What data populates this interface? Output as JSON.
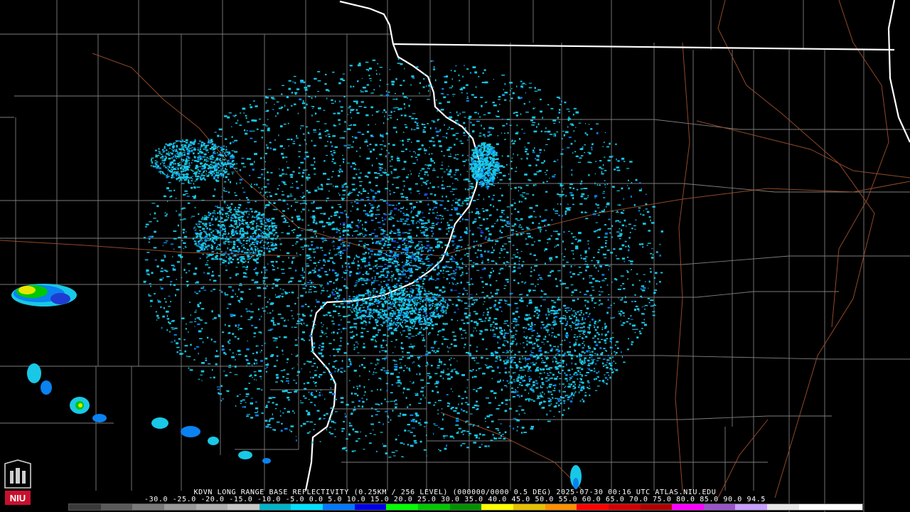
{
  "header": {
    "title": "KDVN LONG RANGE BASE REFLECTIVITY (0.25KM / 256 LEVEL) (000000/0000 0.5 DEG) 2025-07-30 00:16 UTC  ATLAS.NIU.EDU"
  },
  "legend": {
    "scale_text": "-30.0 -25.0 -20.0 -15.0 -10.0 -5.0  0.0   5.0  10.0  15.0  20.0  25.0  30.0  35.0  40.0  45.0  50.0  55.0  60.0  65.0  70.0  75.0  80.0  85.0  90.0  94.5",
    "colors": [
      "#3a3a3a",
      "#5a5a5a",
      "#7a7a7a",
      "#9a9a9a",
      "#b0b0b0",
      "#c8c8c8",
      "#00b4c8",
      "#00e0ff",
      "#0078ff",
      "#0000e6",
      "#00ff00",
      "#00c800",
      "#009000",
      "#ffff00",
      "#e6c000",
      "#ff9000",
      "#ff0000",
      "#d40000",
      "#b00000",
      "#ff00ff",
      "#9955c9",
      "#c8a0ff",
      "#e6e6e6",
      "#ffffff",
      "#ffffff"
    ]
  },
  "logo": {
    "name": "NIU"
  },
  "map": {
    "radar_site": "KDVN",
    "colors": {
      "state_border": "#ffffff",
      "county_border": "#8c8c8c",
      "highway": "#a0522d",
      "echo_light": "#19c8e6",
      "echo_medium": "#0a82f0",
      "echo_heavy": "#1e3cd2"
    }
  }
}
